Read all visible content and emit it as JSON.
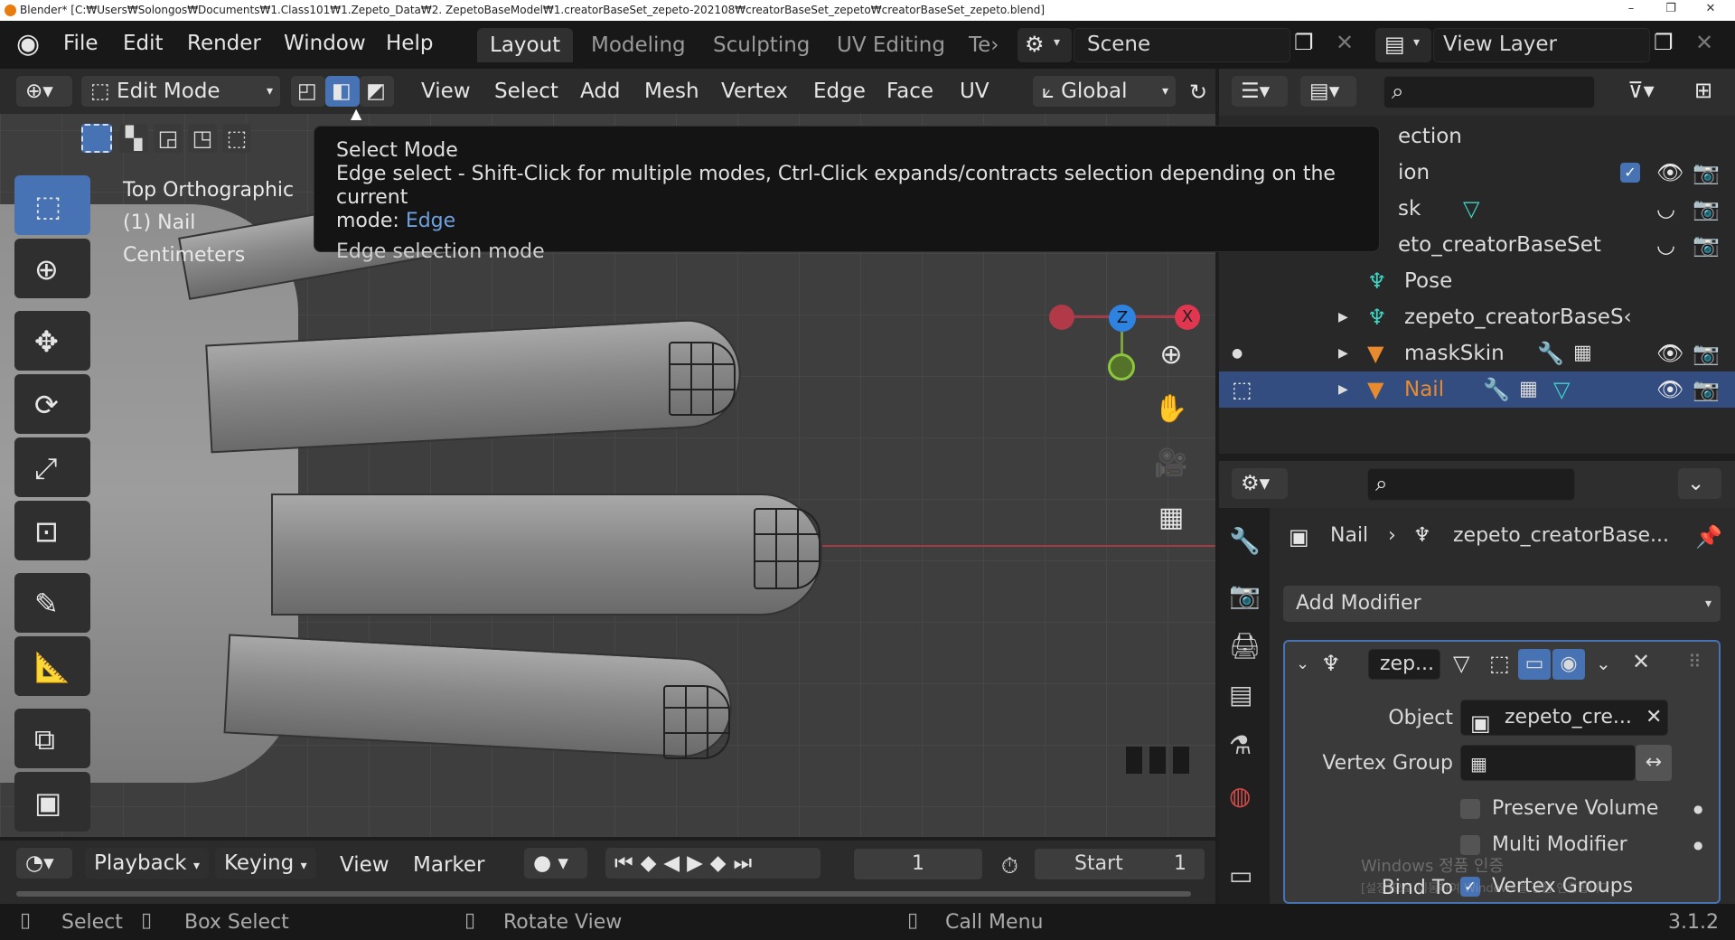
{
  "titlebar": {
    "title": "Blender* [C:₩Users₩Solongos₩Documents₩1.Class101₩1.Zepeto_Data₩2. ZepetoBaseModel₩1.creatorBaseSet_zepeto-202108₩creatorBaseSet_zepeto₩creatorBaseSet_zepeto.blend]",
    "minimize": "–",
    "maximize": "❐",
    "close": "✕"
  },
  "topmenu": {
    "items": [
      "File",
      "Edit",
      "Render",
      "Window",
      "Help"
    ]
  },
  "workspaces": [
    "Layout",
    "Modeling",
    "Sculpting",
    "UV Editing",
    "Te›"
  ],
  "scene": {
    "label": "Scene",
    "view_layer": "View Layer"
  },
  "viewport_header": {
    "mode": "Edit Mode",
    "menus": [
      "View",
      "Select",
      "Add",
      "Mesh",
      "Vertex",
      "Edge",
      "Face",
      "UV"
    ],
    "transform": "Global"
  },
  "viewport_overlay": {
    "view_name": "Top Orthographic",
    "object": "(1) Nail",
    "units": "Centimeters"
  },
  "tooltip": {
    "title": "Select Mode",
    "line1": "Edge select - Shift-Click for multiple modes, Ctrl-Click expands/contracts selection depending on the current",
    "line2_prefix": "mode:",
    "line2_value": "Edge",
    "python": "Edge selection mode"
  },
  "outliner": {
    "rows": [
      {
        "label": "ection",
        "sel": false
      },
      {
        "label": "ion",
        "sel": false
      },
      {
        "label": "sk",
        "sel": false
      },
      {
        "label": "eto_creatorBaseSet",
        "sel": false
      },
      {
        "label": "Pose",
        "sel": false
      },
      {
        "label": "zepeto_creatorBaseS‹",
        "sel": false
      },
      {
        "label": "maskSkin",
        "sel": false
      },
      {
        "label": "Nail",
        "sel": true
      }
    ]
  },
  "properties": {
    "breadcrumb_object": "Nail",
    "breadcrumb_target": "zepeto_creatorBase...",
    "add_modifier": "Add Modifier",
    "modifier_name": "zep...",
    "object_label": "Object",
    "object_value": "zepeto_cre...",
    "vertex_group_label": "Vertex Group",
    "preserve_volume": "Preserve Volume",
    "multi_modifier": "Multi Modifier",
    "bind_to": "Bind To",
    "vertex_groups": "Vertex Groups",
    "watermark1": "Windows 정품 인증",
    "watermark2": "[설정]으로 이동하여 Windows를 정품 인증합니다."
  },
  "timeline": {
    "menus": [
      "Playback",
      "Keying",
      "View",
      "Marker"
    ],
    "current_frame": "1",
    "start_label": "Start",
    "start_value": "1"
  },
  "statusbar": {
    "select": "Select",
    "box_select": "Box Select",
    "rotate_view": "Rotate View",
    "call_menu": "Call Menu",
    "version": "3.1.2"
  },
  "colors": {
    "accent": "#4772b3",
    "selected_row": "#334d80",
    "orange": "#e88a2e"
  }
}
